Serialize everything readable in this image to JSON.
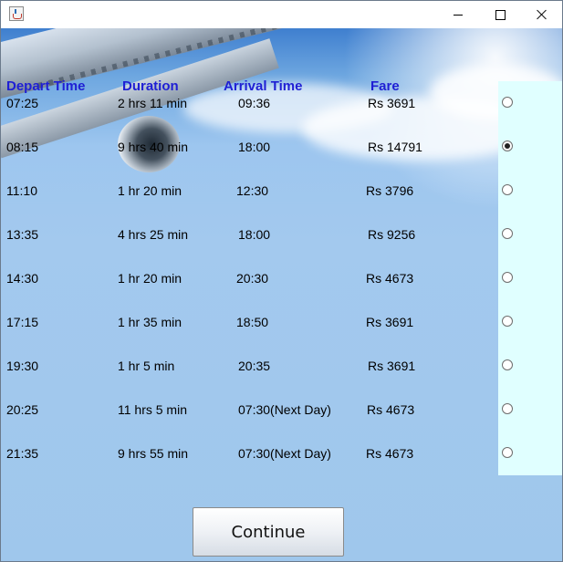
{
  "window": {
    "icon": "java-cup-icon",
    "controls": [
      "minimize-icon",
      "maximize-icon",
      "close-icon"
    ]
  },
  "headers": {
    "depart": "Depart Time",
    "duration": "Duration",
    "arrival": "Arrival Time",
    "fare": "Fare"
  },
  "flights": [
    {
      "depart": "07:25",
      "duration": "2 hrs 11 min",
      "arrival": "09:36",
      "fare": "Rs 3691",
      "selected": false
    },
    {
      "depart": "08:15",
      "duration": "9 hrs 40 min",
      "arrival": "18:00",
      "fare": "Rs 14791",
      "selected": true
    },
    {
      "depart": "11:10",
      "duration": "1 hr 20 min",
      "arrival": "12:30",
      "fare": "Rs 3796",
      "selected": false
    },
    {
      "depart": "13:35",
      "duration": "4 hrs 25 min",
      "arrival": "18:00",
      "fare": "Rs 9256",
      "selected": false
    },
    {
      "depart": "14:30",
      "duration": "1 hr 20 min",
      "arrival": "20:30",
      "fare": "Rs 4673",
      "selected": false
    },
    {
      "depart": "17:15",
      "duration": "1 hr 35 min",
      "arrival": "18:50",
      "fare": "Rs 3691",
      "selected": false
    },
    {
      "depart": "19:30",
      "duration": "1 hr 5 min",
      "arrival": "20:35",
      "fare": "Rs 3691",
      "selected": false
    },
    {
      "depart": "20:25",
      "duration": "11 hrs 5 min",
      "arrival": "07:30(Next Day)",
      "fare": "Rs 4673",
      "selected": false
    },
    {
      "depart": "21:35",
      "duration": "9 hrs 55 min",
      "arrival": "07:30(Next Day)",
      "fare": "Rs 4673",
      "selected": false
    }
  ],
  "continue_label": "Continue",
  "colors": {
    "header_text": "#1f1fd4",
    "radio_panel": "#e0ffff",
    "sky": "#9fc7ec"
  }
}
